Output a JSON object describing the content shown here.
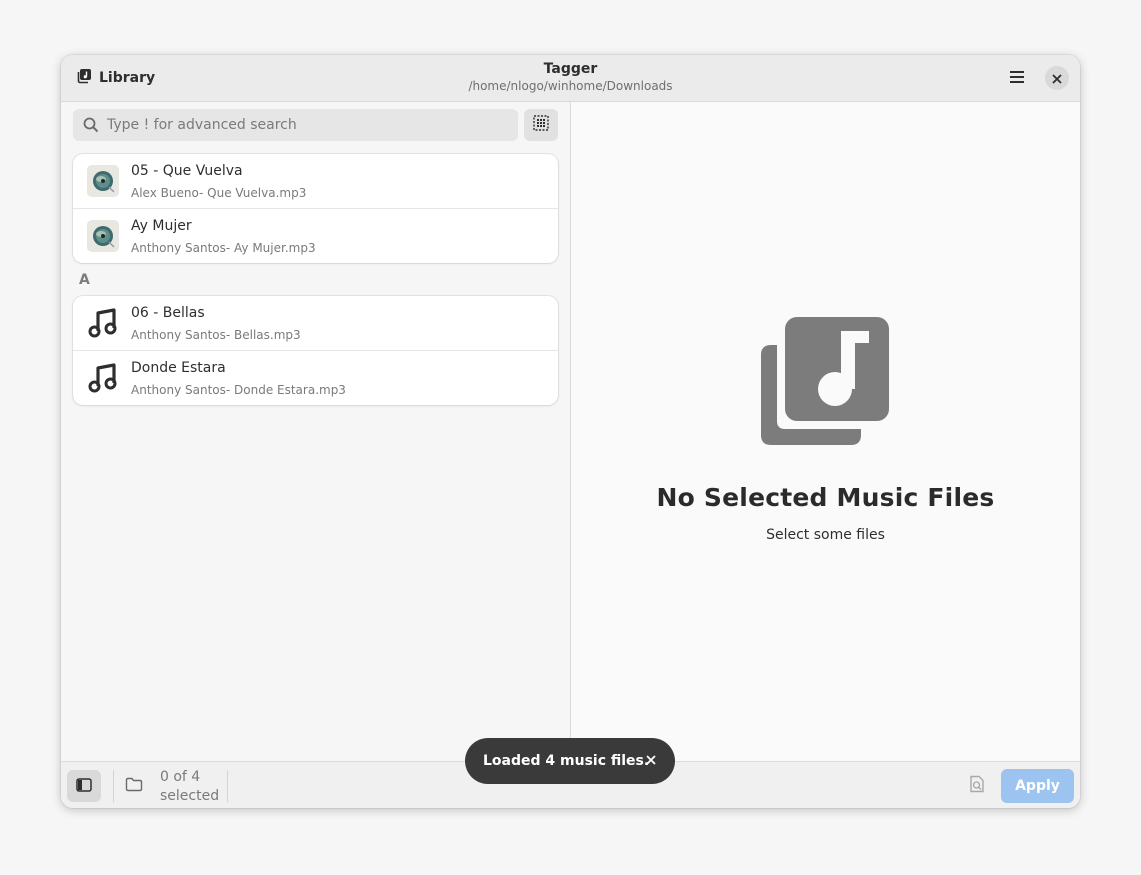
{
  "header": {
    "library_label": "Library",
    "title": "Tagger",
    "subtitle": "/home/nlogo/winhome/Downloads",
    "library_icon": "library-music-icon",
    "menu_icon": "hamburger-menu-icon",
    "close_icon": "close-icon"
  },
  "sidebar": {
    "search_placeholder": "Type ! for advanced search",
    "search_value": "",
    "groups": [
      {
        "letter": "",
        "items": [
          {
            "title": "05 - Que Vuelva",
            "subtitle": "Alex Bueno- Que Vuelva.mp3",
            "art": "album-art"
          },
          {
            "title": "Ay Mujer",
            "subtitle": "Anthony Santos- Ay Mujer.mp3",
            "art": "album-art"
          }
        ]
      },
      {
        "letter": "A",
        "items": [
          {
            "title": "06 - Bellas",
            "subtitle": "Anthony Santos- Bellas.mp3",
            "art": "music-note-icon"
          },
          {
            "title": "Donde Estara",
            "subtitle": "Anthony Santos- Donde Estara.mp3",
            "art": "music-note-icon"
          }
        ]
      }
    ]
  },
  "main": {
    "status_title": "No Selected Music Files",
    "status_description": "Select some files"
  },
  "bottombar": {
    "selection_line1": "0 of 4",
    "selection_line2": "selected",
    "apply_label": "Apply"
  },
  "toast": {
    "message": "Loaded 4 music files."
  },
  "colors": {
    "accent_disabled": "#9dc3f0",
    "toast_bg": "#3a3a3a",
    "status_icon": "#7c7c7c"
  }
}
